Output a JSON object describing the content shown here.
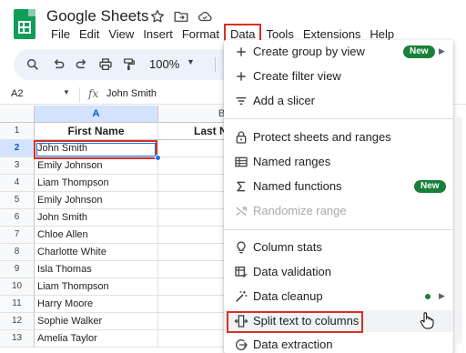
{
  "app": {
    "title": "Google Sheets",
    "icons": [
      "star-icon",
      "move-folder-icon",
      "cloud-saved-icon"
    ]
  },
  "menubar": [
    "File",
    "Edit",
    "View",
    "Insert",
    "Format",
    "Data",
    "Tools",
    "Extensions",
    "Help"
  ],
  "active_menu": "Data",
  "toolbar": {
    "icons": [
      "search-icon",
      "undo-icon",
      "redo-icon",
      "print-icon",
      "paint-format-icon"
    ],
    "zoom": "100%",
    "currency": "$"
  },
  "formula_bar": {
    "cell_ref": "A2",
    "fx": "fx",
    "value": "John Smith"
  },
  "grid": {
    "col_headers": [
      "A",
      "B"
    ],
    "row_numbers": [
      "1",
      "2",
      "3",
      "4",
      "5",
      "6",
      "7",
      "8",
      "9",
      "10",
      "11",
      "12",
      "13"
    ],
    "column_a_header": "First Name",
    "column_b_header": "Last N",
    "column_a_values": [
      "John Smith",
      "Emily Johnson",
      "Liam Thompson",
      "Emily Johnson",
      "John Smith",
      "Chloe Allen",
      "Charlotte White",
      "Isla Thomas",
      "Liam Thompson",
      "Harry Moore",
      "Sophie Walker",
      "Amelia Taylor"
    ],
    "selected_cell": "A2"
  },
  "data_menu": {
    "items": [
      {
        "icon": "plus-icon",
        "label": "Create group by view",
        "badge": "New",
        "submenu": true
      },
      {
        "icon": "plus-icon",
        "label": "Create filter view"
      },
      {
        "icon": "slicer-icon",
        "label": "Add a slicer"
      },
      {
        "icon": "lock-icon",
        "label": "Protect sheets and ranges"
      },
      {
        "icon": "named-ranges-icon",
        "label": "Named ranges"
      },
      {
        "icon": "sigma-icon",
        "label": "Named functions",
        "badge": "New"
      },
      {
        "icon": "shuffle-icon",
        "label": "Randomize range",
        "disabled": true
      },
      {
        "icon": "lightbulb-icon",
        "label": "Column stats"
      },
      {
        "icon": "data-validation-icon",
        "label": "Data validation"
      },
      {
        "icon": "magic-wand-icon",
        "label": "Data cleanup",
        "dot": true,
        "submenu": true
      },
      {
        "icon": "split-columns-icon",
        "label": "Split text to columns",
        "highlighted": true
      },
      {
        "icon": "data-extraction-icon",
        "label": "Data extraction"
      }
    ]
  },
  "colors": {
    "accent_red": "#d93025",
    "selection_blue": "#1a73e8",
    "badge_green": "#188038",
    "toolbar_bg": "#edf2fa"
  }
}
